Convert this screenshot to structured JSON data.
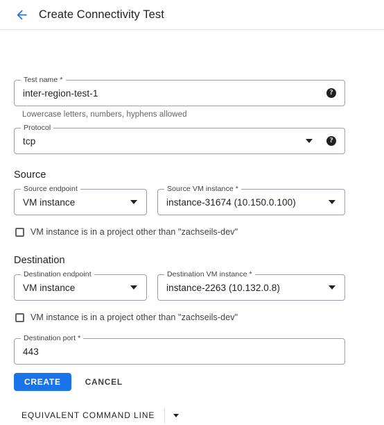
{
  "header": {
    "back_icon": "arrow-left-icon",
    "title": "Create Connectivity Test",
    "accent_color": "#1a73e8"
  },
  "form": {
    "test_name": {
      "label": "Test name *",
      "value": "inter-region-test-1",
      "hint": "Lowercase letters, numbers, hyphens allowed",
      "help_icon": "help-icon",
      "help_glyph": "?"
    },
    "protocol": {
      "label": "Protocol",
      "value": "tcp",
      "caret_icon": "chevron-down-icon",
      "help_icon": "help-icon",
      "help_glyph": "?"
    },
    "source": {
      "section_label": "Source",
      "endpoint": {
        "label": "Source endpoint",
        "value": "VM instance",
        "caret_icon": "chevron-down-icon"
      },
      "vm_instance": {
        "label": "Source VM instance *",
        "value": "instance-31674 (10.150.0.100)",
        "caret_icon": "chevron-down-icon"
      },
      "other_project_checkbox": {
        "label": "VM instance is in a project other than \"zachseils-dev\"",
        "checked": false
      }
    },
    "destination": {
      "section_label": "Destination",
      "endpoint": {
        "label": "Destination endpoint",
        "value": "VM instance",
        "caret_icon": "chevron-down-icon"
      },
      "vm_instance": {
        "label": "Destination VM instance *",
        "value": "instance-2263 (10.132.0.8)",
        "caret_icon": "chevron-down-icon"
      },
      "other_project_checkbox": {
        "label": "VM instance is in a project other than \"zachseils-dev\"",
        "checked": false
      },
      "port": {
        "label": "Destination port *",
        "value": "443"
      }
    }
  },
  "actions": {
    "create_label": "CREATE",
    "cancel_label": "CANCEL",
    "primary_color": "#1a73e8"
  },
  "command_line": {
    "label": "EQUIVALENT COMMAND LINE",
    "caret_icon": "chevron-down-icon"
  }
}
